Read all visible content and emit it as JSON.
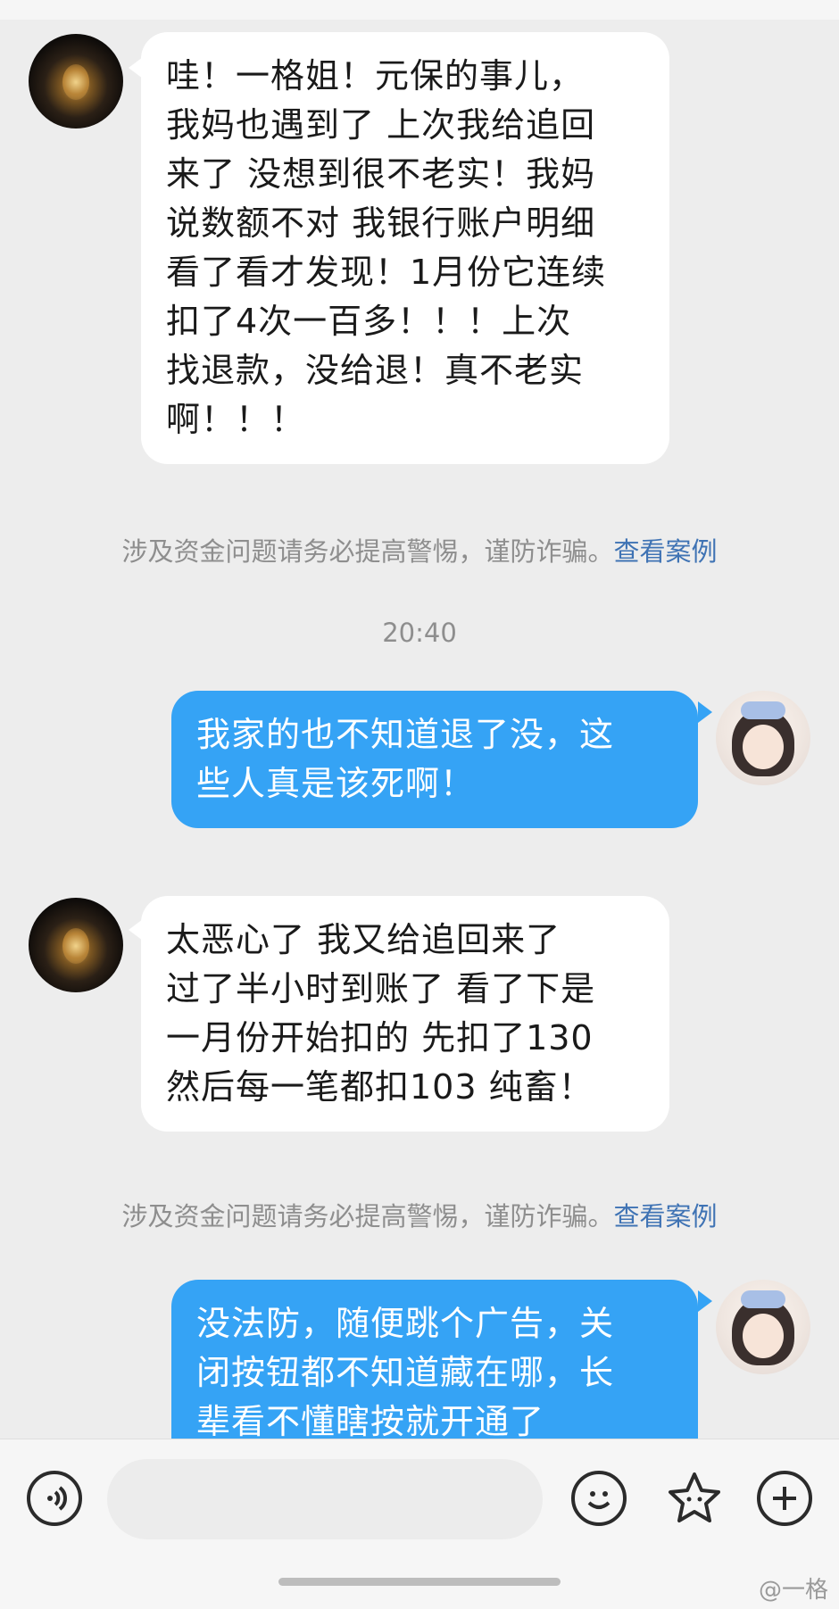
{
  "messages": [
    {
      "side": "left",
      "text": "哇！一格姐！元保的事儿，\n我妈也遇到了 上次我给追回\n来了 没想到很不老实！我妈\n说数额不对 我银行账户明细\n看了看才发现！1月份它连续\n扣了4次一百多！！！上次\n找退款，没给退！真不老实\n啊！！！"
    },
    {
      "side": "right",
      "text": "我家的也不知道退了没，这\n些人真是该死啊！"
    },
    {
      "side": "left",
      "text": "太恶心了 我又给追回来了\n过了半小时到账了 看了下是\n一月份开始扣的 先扣了130\n然后每一笔都扣103 纯畜！"
    },
    {
      "side": "right",
      "text": "没法防，随便跳个广告，关\n闭按钮都不知道藏在哪，长\n辈看不懂瞎按就开通了"
    }
  ],
  "notices": [
    {
      "text": "涉及资金问题请务必提高警惕，谨防诈骗。",
      "link": "查看案例"
    },
    {
      "text": "涉及资金问题请务必提高警惕，谨防诈骗。",
      "link": "查看案例"
    }
  ],
  "timestamp": "20:40",
  "watermark": "@一格",
  "icons": {
    "voice": "voice-icon",
    "emoji": "emoji-icon",
    "sticker": "sticker-icon",
    "plus": "plus-icon"
  },
  "colors": {
    "background": "#ededed",
    "bubble_right": "#35a3f5",
    "bubble_left": "#ffffff",
    "link": "#3f73b4",
    "notice": "#8e8e8e"
  }
}
